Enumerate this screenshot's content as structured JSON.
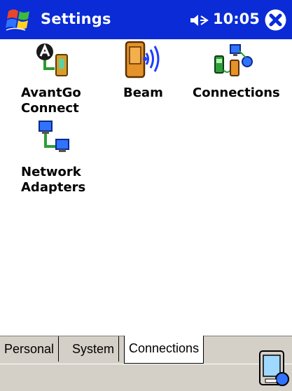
{
  "titlebar": {
    "title": "Settings",
    "time": "10:05",
    "start_icon": "windows-flag-icon",
    "volume_icon": "speaker-icon",
    "close_icon": "close-icon"
  },
  "items": [
    {
      "label": "AvantGo\nConnect",
      "icon": "avantgo-icon"
    },
    {
      "label": "Beam",
      "icon": "beam-icon"
    },
    {
      "label": "Connections",
      "icon": "connections-icon"
    },
    {
      "label": "Network\nAdapters",
      "icon": "network-adapters-icon"
    }
  ],
  "tabs": [
    {
      "label": "Personal"
    },
    {
      "label": "System"
    },
    {
      "label": "Connections",
      "active": true
    }
  ],
  "menubar": {
    "sip_icon": "input-panel-icon"
  },
  "colors": {
    "titlebar": "#0a2bd6",
    "chrome": "#d4d0c8"
  }
}
